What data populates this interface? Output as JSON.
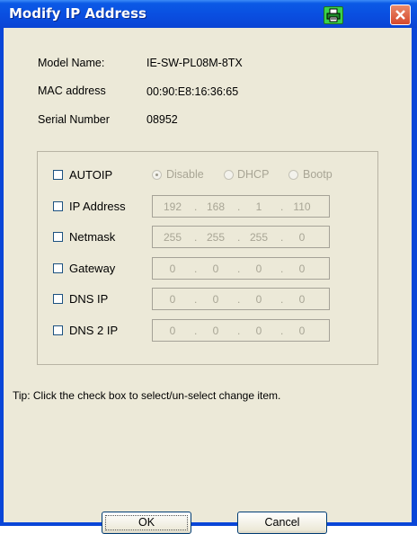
{
  "window": {
    "title": "Modify IP Address"
  },
  "info": [
    {
      "label": "Model Name:",
      "value": "IE-SW-PL08M-8TX"
    },
    {
      "label": "MAC address",
      "value": "00:90:E8:16:36:65"
    },
    {
      "label": "Serial Number",
      "value": "08952"
    }
  ],
  "autoip": {
    "label": "AUTOIP",
    "options": [
      "Disable",
      "DHCP",
      "Bootp"
    ],
    "selected": "Disable"
  },
  "fields": [
    {
      "label": "IP Address",
      "octets": [
        "192",
        "168",
        "1",
        "110"
      ]
    },
    {
      "label": "Netmask",
      "octets": [
        "255",
        "255",
        "255",
        "0"
      ]
    },
    {
      "label": "Gateway",
      "octets": [
        "0",
        "0",
        "0",
        "0"
      ]
    },
    {
      "label": "DNS IP",
      "octets": [
        "0",
        "0",
        "0",
        "0"
      ]
    },
    {
      "label": "DNS 2 IP",
      "octets": [
        "0",
        "0",
        "0",
        "0"
      ]
    }
  ],
  "tip": "Tip: Click the check box to select/un-select change item.",
  "buttons": {
    "ok": "OK",
    "cancel": "Cancel"
  },
  "icons": {
    "title_button": "printer-icon",
    "close": "close-icon"
  }
}
